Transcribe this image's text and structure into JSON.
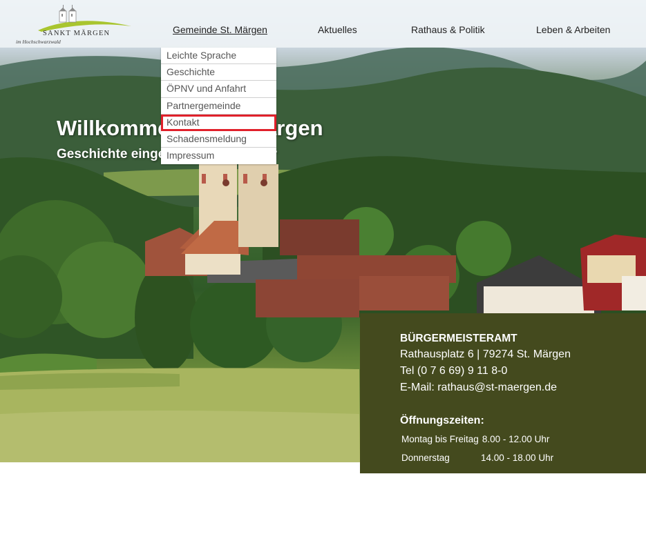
{
  "logo": {
    "name": "SANKT MÄRGEN",
    "subtitle": "im Hochschwarzwald"
  },
  "nav": {
    "items": [
      {
        "label": "Gemeinde St. Märgen"
      },
      {
        "label": "Aktuelles"
      },
      {
        "label": "Rathaus & Politik"
      },
      {
        "label": "Leben & Arbeiten"
      }
    ]
  },
  "dropdown": {
    "items": [
      {
        "label": "Leichte Sprache"
      },
      {
        "label": "Geschichte"
      },
      {
        "label": "ÖPNV und Anfahrt"
      },
      {
        "label": "Partnergemeinde"
      },
      {
        "label": "Kontakt"
      },
      {
        "label": "Schadensmeldung"
      },
      {
        "label": "Impressum"
      }
    ]
  },
  "hero": {
    "title": "Willkommen in St. Märgen",
    "subtitle": "Geschichte eingebettet in die Natur"
  },
  "info": {
    "title": "BÜRGERMEISTERAMT",
    "address": "Rathausplatz 6 | 79274 St. Märgen",
    "tel": "Tel (0 7 6 69) 9 11 8-0",
    "email": "E-Mail: rathaus@st-maergen.de",
    "hours_title": "Öffnungszeiten:",
    "hours": [
      {
        "days": "Montag bis Freitag",
        "time": "8.00 - 12.00 Uhr"
      },
      {
        "days": "Donnerstag",
        "time": "14.00 - 18.00 Uhr"
      }
    ]
  },
  "colors": {
    "infobox_bg": "#444a1e",
    "highlight": "#e0202a",
    "header_bg": "#f0f4f7"
  }
}
